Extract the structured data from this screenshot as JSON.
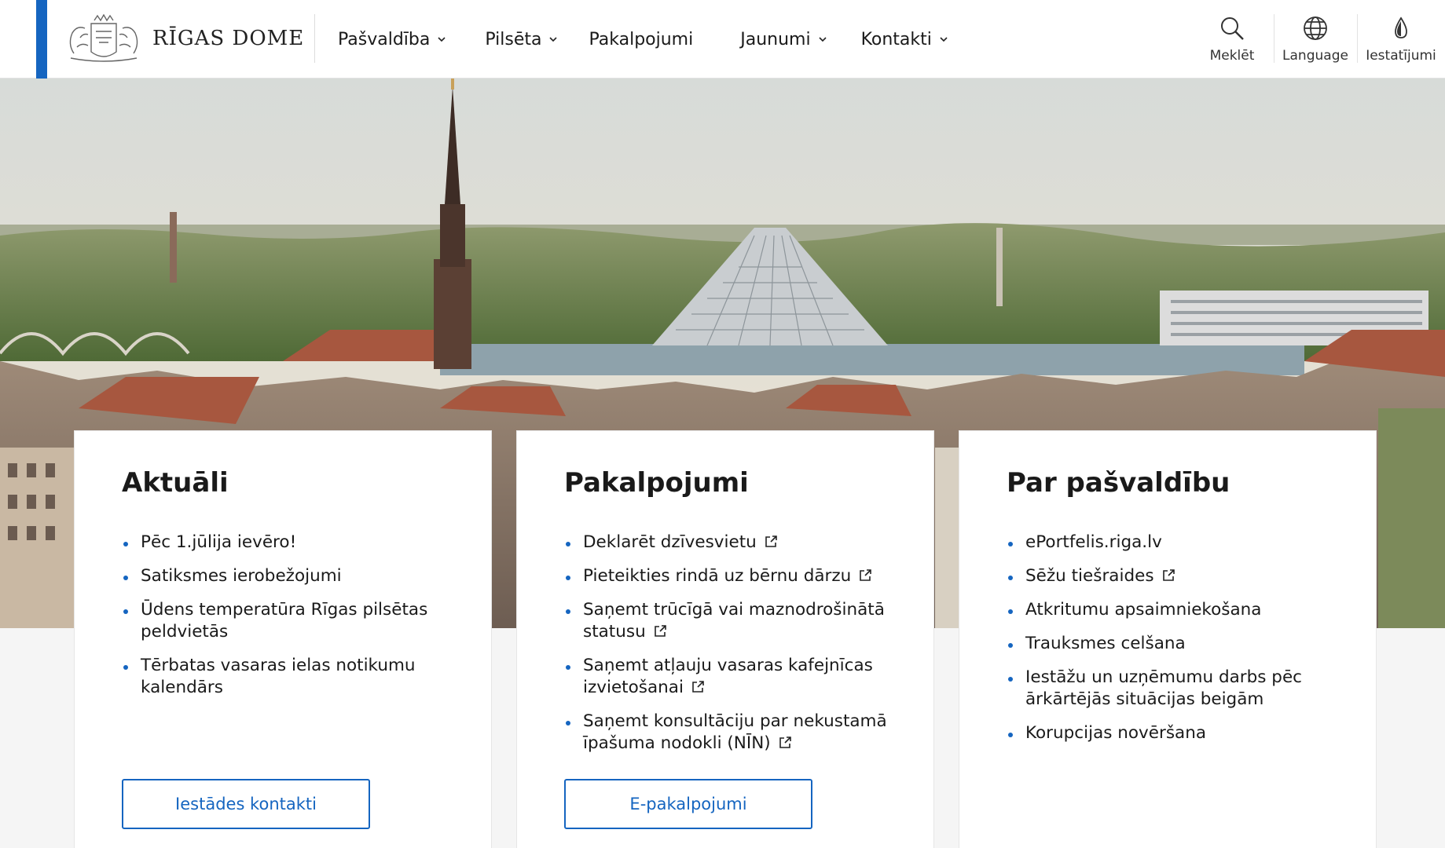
{
  "header": {
    "logo_text": "RĪGAS  DOME",
    "nav": [
      {
        "label": "Pašvaldība",
        "has_dropdown": true
      },
      {
        "label": "Pilsēta",
        "has_dropdown": true
      },
      {
        "label": "Pakalpojumi",
        "has_dropdown": false
      },
      {
        "label": "Jaunumi",
        "has_dropdown": true
      },
      {
        "label": "Kontakti",
        "has_dropdown": true
      }
    ],
    "tools": [
      {
        "label": "Meklēt",
        "icon": "search-icon"
      },
      {
        "label": "Language",
        "icon": "globe-icon"
      },
      {
        "label": "Iestatījumi",
        "icon": "drop-icon"
      }
    ]
  },
  "colors": {
    "accent": "#1565c0",
    "text": "#1a1a1a",
    "background": "#f5f5f5"
  },
  "cards": [
    {
      "title": "Aktuāli",
      "items": [
        {
          "text": "Pēc 1.jūlija ievēro!",
          "external": false
        },
        {
          "text": "Satiksmes ierobežojumi",
          "external": false
        },
        {
          "text": "Ūdens temperatūra Rīgas pilsētas peldvietās",
          "external": false
        },
        {
          "text": "Tērbatas vasaras ielas notikumu kalendārs",
          "external": false
        }
      ],
      "button": "Iestādes kontakti"
    },
    {
      "title": "Pakalpojumi",
      "items": [
        {
          "text": "Deklarēt dzīvesvietu",
          "external": true
        },
        {
          "text": "Pieteikties rindā uz bērnu dārzu",
          "external": true
        },
        {
          "text": "Saņemt trūcīgā vai maznodrošinātā statusu",
          "external": true
        },
        {
          "text": "Saņemt atļauju vasaras kafejnīcas izvietošanai",
          "external": true
        },
        {
          "text": "Saņemt konsultāciju par nekustamā īpašuma nodokli (NĪN)",
          "external": true
        }
      ],
      "button": "E-pakalpojumi"
    },
    {
      "title": "Par pašvaldību",
      "items": [
        {
          "text": "ePortfelis.riga.lv",
          "external": false
        },
        {
          "text": "Sēžu tiešraides",
          "external": true
        },
        {
          "text": "Atkritumu apsaimniekošana",
          "external": false
        },
        {
          "text": "Trauksmes celšana",
          "external": false
        },
        {
          "text": "Iestāžu un uzņēmumu darbs pēc ārkārtējās situācijas beigām",
          "external": false
        },
        {
          "text": "Korupcijas novēršana",
          "external": false
        }
      ],
      "button": null
    }
  ]
}
